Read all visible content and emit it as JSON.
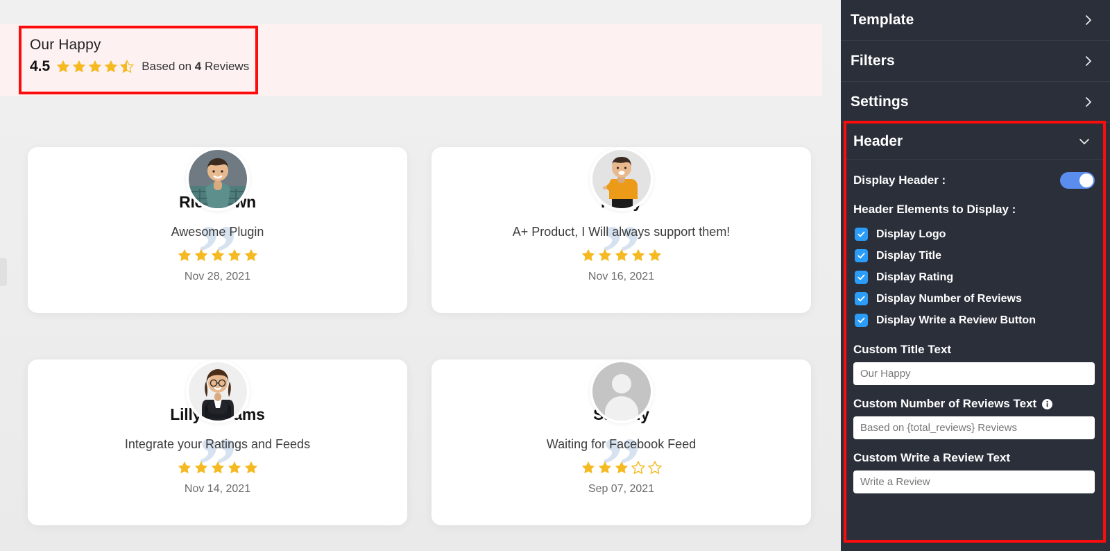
{
  "preview": {
    "header": {
      "title": "Our Happy",
      "rating_value": "4.5",
      "stars_filled": 4,
      "stars_half": 1,
      "reviews_prefix": "Based on ",
      "reviews_count": "4",
      "reviews_suffix": " Reviews",
      "banner_bg": "#fdf1f1",
      "highlight_color": "#fc0d0d"
    },
    "reviews": [
      {
        "name": "RickGown",
        "text": "Awesome Plugin",
        "stars": 5,
        "date": "Nov 28, 2021",
        "avatar": "photo-man-plaid-shirt"
      },
      {
        "name": "Harry",
        "text": "A+ Product, I Will always support them!",
        "stars": 5,
        "date": "Nov 16, 2021",
        "avatar": "photo-man-orange-sweater"
      },
      {
        "name": "LillyWilliams",
        "text": "Integrate your Ratings and Feeds",
        "stars": 5,
        "date": "Nov 14, 2021",
        "avatar": "photo-woman-glasses-blazer"
      },
      {
        "name": "Sammy",
        "text": "Waiting for Facebook Feed",
        "stars": 3,
        "date": "Sep 07, 2021",
        "avatar": "default-user-silhouette"
      }
    ]
  },
  "sidebar": {
    "accordions": [
      {
        "label": "Template",
        "icon": "chevron-right-icon",
        "expanded": false
      },
      {
        "label": "Filters",
        "icon": "chevron-right-icon",
        "expanded": false
      },
      {
        "label": "Settings",
        "icon": "chevron-right-icon",
        "expanded": false
      }
    ],
    "header_section": {
      "label": "Header",
      "icon": "chevron-down-icon",
      "expanded": true,
      "display_header": {
        "label": "Display Header :",
        "value": "on",
        "toggle_color": "#5b8def"
      },
      "elements_label": "Header Elements to Display :",
      "checkboxes": [
        {
          "label": "Display Logo",
          "checked": true
        },
        {
          "label": "Display Title",
          "checked": true
        },
        {
          "label": "Display Rating",
          "checked": true
        },
        {
          "label": "Display Number of Reviews",
          "checked": true
        },
        {
          "label": "Display Write a Review Button",
          "checked": true
        }
      ],
      "fields": [
        {
          "label": "Custom Title Text",
          "info": false,
          "placeholder": "Our Happy",
          "value": ""
        },
        {
          "label": "Custom Number of Reviews Text",
          "info": true,
          "info_icon": "info-circle-icon",
          "placeholder": "Based on {total_reviews} Reviews",
          "value": ""
        },
        {
          "label": "Custom Write a Review Text",
          "info": false,
          "placeholder": "Write a Review",
          "value": ""
        }
      ]
    },
    "checkbox_color": "#2b9cf8",
    "background": "#2a2f3a",
    "highlight_color": "#fc0d0d"
  }
}
